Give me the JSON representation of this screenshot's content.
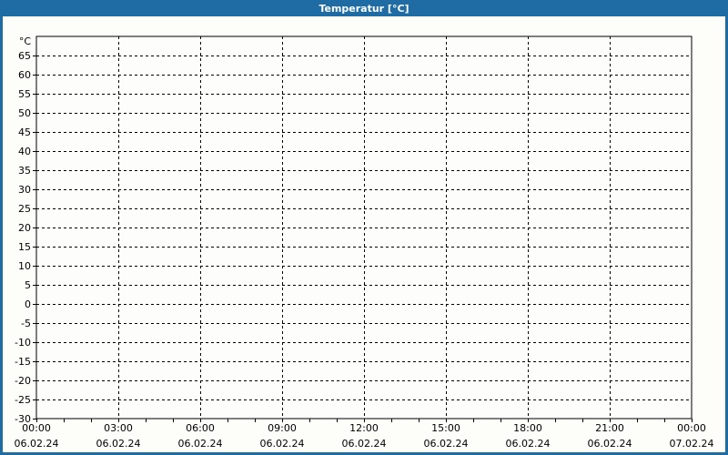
{
  "window": {
    "title": "Temperatur [°C]"
  },
  "colors": {
    "frame_blue": "#1f6ba4",
    "title_text": "#ffffff",
    "page_background": "#fdfdfa",
    "plot_background": "#fdfdfb",
    "axis_line": "#000000",
    "grid_line": "#000000",
    "label_text": "#000000"
  },
  "chart_data": {
    "type": "line",
    "title": "Temperatur [°C]",
    "ylabel": "°C",
    "y_unit_label": "°C",
    "ylim": [
      -30,
      70
    ],
    "y_tick_step": 5,
    "y_ticks": [
      65,
      60,
      55,
      50,
      45,
      40,
      35,
      30,
      25,
      20,
      15,
      10,
      5,
      0,
      -5,
      -10,
      -15,
      -20,
      -25,
      -30
    ],
    "x_axis": {
      "minor_tick_interval_hours": 1,
      "major_tick_interval_hours": 3,
      "total_hours": 24,
      "major_ticks": [
        {
          "hour": 0,
          "time": "00:00",
          "date": "06.02.24"
        },
        {
          "hour": 3,
          "time": "03:00",
          "date": "06.02.24"
        },
        {
          "hour": 6,
          "time": "06:00",
          "date": "06.02.24"
        },
        {
          "hour": 9,
          "time": "09:00",
          "date": "06.02.24"
        },
        {
          "hour": 12,
          "time": "12:00",
          "date": "06.02.24"
        },
        {
          "hour": 15,
          "time": "15:00",
          "date": "06.02.24"
        },
        {
          "hour": 18,
          "time": "18:00",
          "date": "06.02.24"
        },
        {
          "hour": 21,
          "time": "21:00",
          "date": "06.02.24"
        },
        {
          "hour": 24,
          "time": "00:00",
          "date": "07.02.24"
        }
      ]
    },
    "grid": {
      "style": "dashed",
      "horizontal": true,
      "vertical": true
    },
    "legend_position": "none",
    "series": []
  }
}
